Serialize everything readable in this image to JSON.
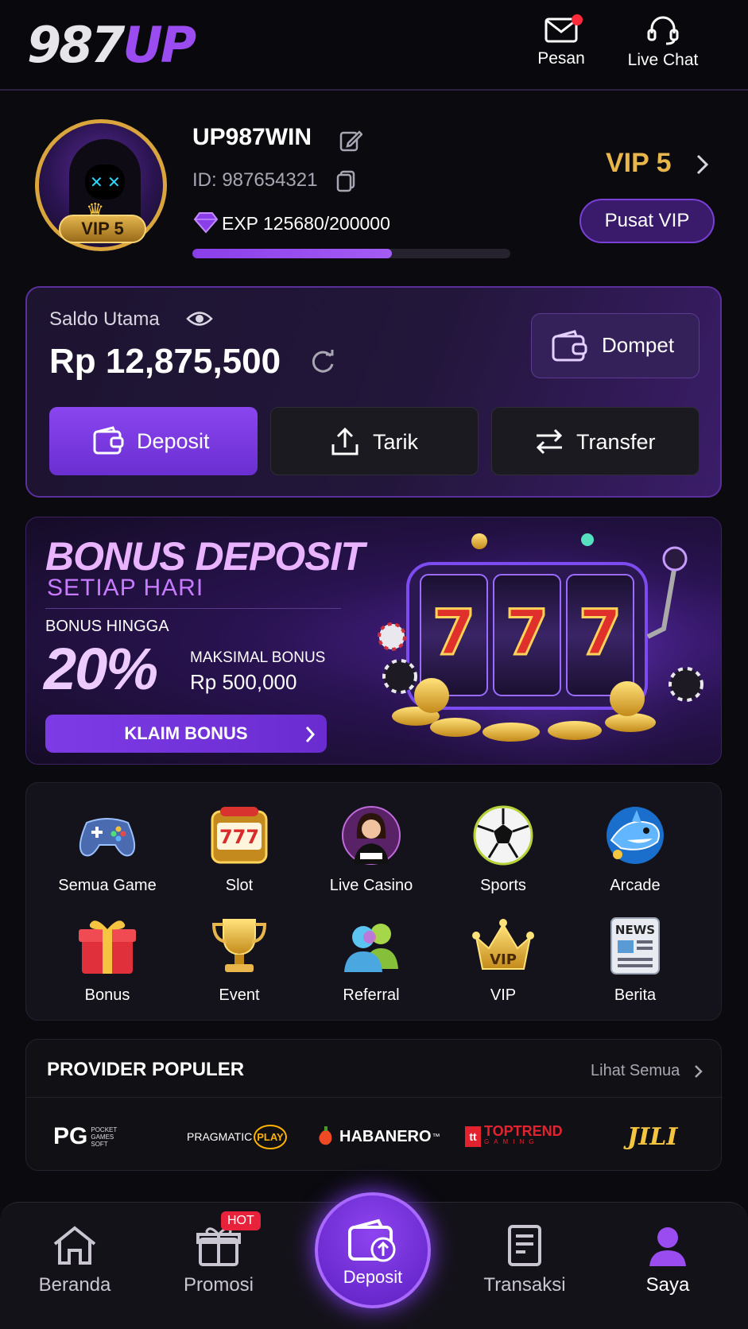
{
  "header": {
    "logo_part1": "987",
    "logo_part2": "UP",
    "message_label": "Pesan",
    "chat_label": "Live Chat"
  },
  "profile": {
    "username": "UP987WIN",
    "id_text": "ID: 987654321",
    "exp_text": "EXP 125680/200000",
    "exp_progress": 0.6284,
    "avatar_badge": "VIP 5",
    "vip_level": "VIP 5",
    "vip_center_label": "Pusat VIP"
  },
  "balance": {
    "label": "Saldo Utama",
    "amount": "Rp 12,875,500",
    "wallet_label": "Dompet",
    "deposit_label": "Deposit",
    "withdraw_label": "Tarik",
    "transfer_label": "Transfer"
  },
  "banner": {
    "title": "BONUS DEPOSIT",
    "subtitle": "SETIAP HARI",
    "bonus_label": "BONUS HINGGA",
    "bonus_percent": "20%",
    "max_label": "MAKSIMAL BONUS",
    "max_value": "Rp 500,000",
    "cta": "KLAIM BONUS",
    "reel_digits": [
      "7",
      "7",
      "7"
    ]
  },
  "games": [
    {
      "label": "Semua Game",
      "icon": "gamepad-icon"
    },
    {
      "label": "Slot",
      "icon": "slot-machine-icon"
    },
    {
      "label": "Live Casino",
      "icon": "dealer-icon"
    },
    {
      "label": "Sports",
      "icon": "soccer-ball-icon"
    },
    {
      "label": "Arcade",
      "icon": "shark-icon"
    },
    {
      "label": "Bonus",
      "icon": "gift-icon"
    },
    {
      "label": "Event",
      "icon": "trophy-icon"
    },
    {
      "label": "Referral",
      "icon": "people-icon"
    },
    {
      "label": "VIP",
      "icon": "crown-icon",
      "badge": "VIP"
    },
    {
      "label": "Berita",
      "icon": "newspaper-icon",
      "badge": "NEWS"
    }
  ],
  "providers": {
    "title": "PROVIDER POPULER",
    "see_all": "Lihat Semua",
    "items": [
      {
        "name": "PG",
        "sub": "POCKET GAMES SOFT"
      },
      {
        "name": "PRAGMATIC",
        "sub": "PLAY"
      },
      {
        "name": "HABANERO",
        "sub": "™"
      },
      {
        "name": "TOPTREND",
        "sub": "GAMING"
      },
      {
        "name": "JILI",
        "sub": ""
      }
    ]
  },
  "nav": {
    "home": "Beranda",
    "promo": "Promosi",
    "hot_badge": "HOT",
    "deposit": "Deposit",
    "transactions": "Transaksi",
    "me": "Saya"
  },
  "colors": {
    "accent_purple": "#8a45ef",
    "gold": "#e8b64a",
    "notification_red": "#ff2b3a"
  }
}
